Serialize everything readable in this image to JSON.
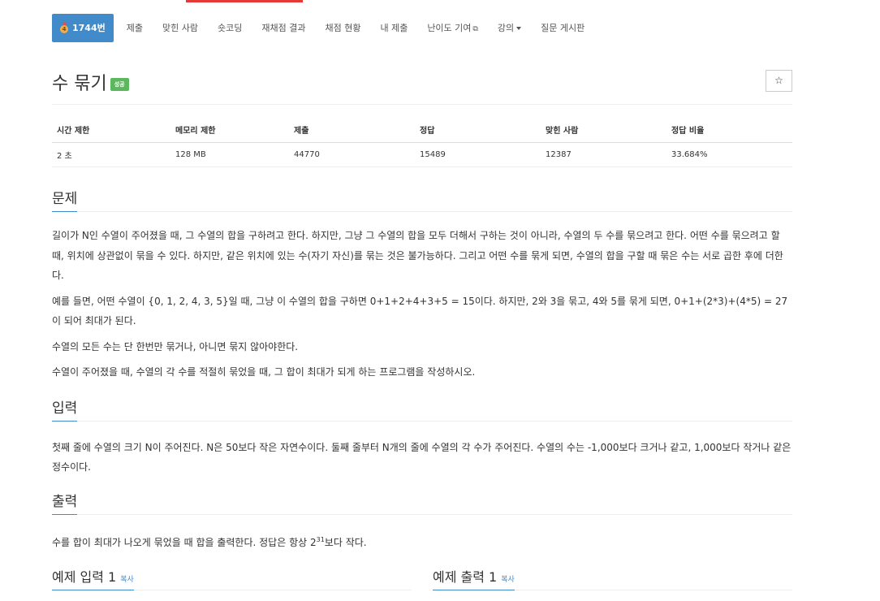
{
  "nav": {
    "problem_number": "1744번",
    "medal_digit": "4",
    "items": [
      "제출",
      "맞힌 사람",
      "숏코딩",
      "재채점 결과",
      "채점 현황",
      "내 제출"
    ],
    "difficulty": "난이도 기여",
    "lectures": "강의",
    "board": "질문 게시판"
  },
  "title": {
    "text": "수 묶기",
    "badge": "성공",
    "star": "☆"
  },
  "stats": {
    "headers": [
      "시간 제한",
      "메모리 제한",
      "제출",
      "정답",
      "맞힌 사람",
      "정답 비율"
    ],
    "values": [
      "2 초",
      "128 MB",
      "44770",
      "15489",
      "12387",
      "33.684%"
    ]
  },
  "problem": {
    "heading": "문제",
    "p1": "길이가 N인 수열이 주어졌을 때, 그 수열의 합을 구하려고 한다. 하지만, 그냥 그 수열의 합을 모두 더해서 구하는 것이 아니라, 수열의 두 수를 묶으려고 한다. 어떤 수를 묶으려고 할 때, 위치에 상관없이 묶을 수 있다. 하지만, 같은 위치에 있는 수(자기 자신)를 묶는 것은 불가능하다. 그리고 어떤 수를 묶게 되면, 수열의 합을 구할 때 묶은 수는 서로 곱한 후에 더한다.",
    "p2": "예를 들면, 어떤 수열이 {0, 1, 2, 4, 3, 5}일 때, 그냥 이 수열의 합을 구하면 0+1+2+4+3+5 = 15이다. 하지만, 2와 3을 묶고, 4와 5를 묶게 되면, 0+1+(2*3)+(4*5) = 27이 되어 최대가 된다.",
    "p3": "수열의 모든 수는 단 한번만 묶거나, 아니면 묶지 않아야한다.",
    "p4": "수열이 주어졌을 때, 수열의 각 수를 적절히 묶었을 때, 그 합이 최대가 되게 하는 프로그램을 작성하시오."
  },
  "input": {
    "heading": "입력",
    "p1": "첫째 줄에 수열의 크기 N이 주어진다. N은 50보다 작은 자연수이다. 둘째 줄부터 N개의 줄에 수열의 각 수가 주어진다. 수열의 수는 -1,000보다 크거나 같고, 1,000보다 작거나 같은 정수이다."
  },
  "output": {
    "heading": "출력",
    "pre": "수를 합이 최대가 나오게 묶었을 때 합을 출력한다. 정답은 항상 2",
    "sup": "31",
    "post": "보다 작다."
  },
  "samples": {
    "input_heading": "예제 입력 1",
    "output_heading": "예제 출력 1",
    "copy": "복사"
  },
  "colors": {
    "primary": "#428bca",
    "success": "#5cb85c",
    "medal": "#f0ad4e",
    "top_strip": "#e53935"
  }
}
